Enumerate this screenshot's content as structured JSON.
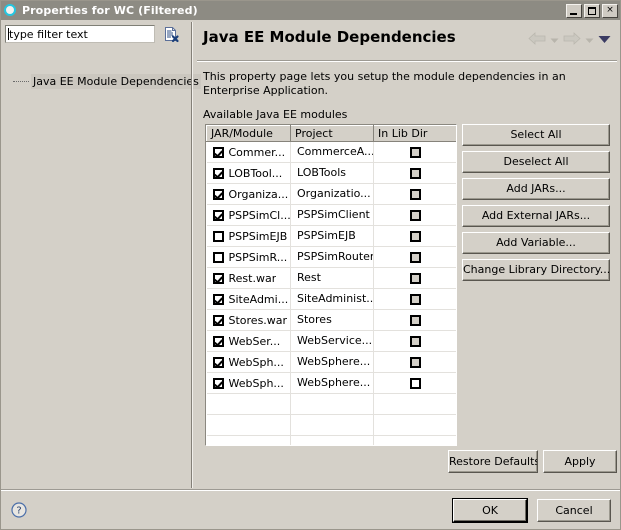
{
  "window": {
    "title": "Properties for WC (Filtered)",
    "icon": "properties-ring-icon",
    "minimize_label": "Minimize",
    "maximize_label": "Maximize",
    "close_label": "×"
  },
  "sidebar": {
    "filter": {
      "value": "type filter text",
      "placeholder": "type filter text",
      "clear_icon": "clear-filter-icon"
    },
    "tree": {
      "items": [
        {
          "label": "Java EE Module Dependencies",
          "selected": true
        }
      ]
    }
  },
  "page": {
    "title": "Java EE Module Dependencies",
    "description": "This property page lets you setup the module dependencies in an Enterprise Application.",
    "section_label": "Available Java EE modules",
    "nav": {
      "back_icon": "back-arrow-icon",
      "back_menu_icon": "chevron-down-icon",
      "forward_icon": "forward-arrow-icon",
      "forward_menu_icon": "chevron-down-icon",
      "menu_icon": "dropdown-arrow-icon"
    }
  },
  "table": {
    "columns": [
      "JAR/Module",
      "Project",
      "In Lib Dir"
    ],
    "rows": [
      {
        "checked": true,
        "module": "Commer...",
        "project": "CommerceA...",
        "in_lib_dir": false,
        "lib_style": "gray"
      },
      {
        "checked": true,
        "module": "LOBTool...",
        "project": "LOBTools",
        "in_lib_dir": false,
        "lib_style": "gray"
      },
      {
        "checked": true,
        "module": "Organiza...",
        "project": "Organizatio...",
        "in_lib_dir": false,
        "lib_style": "gray"
      },
      {
        "checked": true,
        "module": "PSPSimCl...",
        "project": "PSPSimClient",
        "in_lib_dir": false,
        "lib_style": "gray"
      },
      {
        "checked": false,
        "module": "PSPSimEJB",
        "project": "PSPSimEJB",
        "in_lib_dir": false,
        "lib_style": "gray"
      },
      {
        "checked": false,
        "module": "PSPSimR...",
        "project": "PSPSimRouter",
        "in_lib_dir": false,
        "lib_style": "gray"
      },
      {
        "checked": true,
        "module": "Rest.war",
        "project": "Rest",
        "in_lib_dir": false,
        "lib_style": "gray"
      },
      {
        "checked": true,
        "module": "SiteAdmi...",
        "project": "SiteAdminist...",
        "in_lib_dir": false,
        "lib_style": "gray"
      },
      {
        "checked": true,
        "module": "Stores.war",
        "project": "Stores",
        "in_lib_dir": false,
        "lib_style": "gray"
      },
      {
        "checked": true,
        "module": "WebSer...",
        "project": "WebService...",
        "in_lib_dir": false,
        "lib_style": "gray"
      },
      {
        "checked": true,
        "module": "WebSph...",
        "project": "WebSphere...",
        "in_lib_dir": false,
        "lib_style": "gray"
      },
      {
        "checked": true,
        "module": "WebSph...",
        "project": "WebSphere...",
        "in_lib_dir": false,
        "lib_style": "white"
      }
    ],
    "empty_row_count": 5
  },
  "side_buttons": [
    {
      "label": "Select All"
    },
    {
      "label": "Deselect All"
    },
    {
      "label": "Add JARs..."
    },
    {
      "label": "Add External JARs..."
    },
    {
      "label": "Add Variable..."
    },
    {
      "label": "Change Library Directory..."
    }
  ],
  "page_buttons": {
    "restore_defaults": "Restore Defaults",
    "apply": "Apply"
  },
  "footer": {
    "help_icon": "help-question-icon",
    "ok": "OK",
    "cancel": "Cancel"
  },
  "colors": {
    "window_bg": "#d4d0c8",
    "titlebar_bg": "#8d8b83",
    "titlebar_text": "#ffffff",
    "accent_icon": "#24c6e0",
    "nav_arrow": "#cbc8c0",
    "nav_menu_arrow": "#3b3b63",
    "table_bg": "#ffffff",
    "grid_line": "#e3e1dd"
  }
}
